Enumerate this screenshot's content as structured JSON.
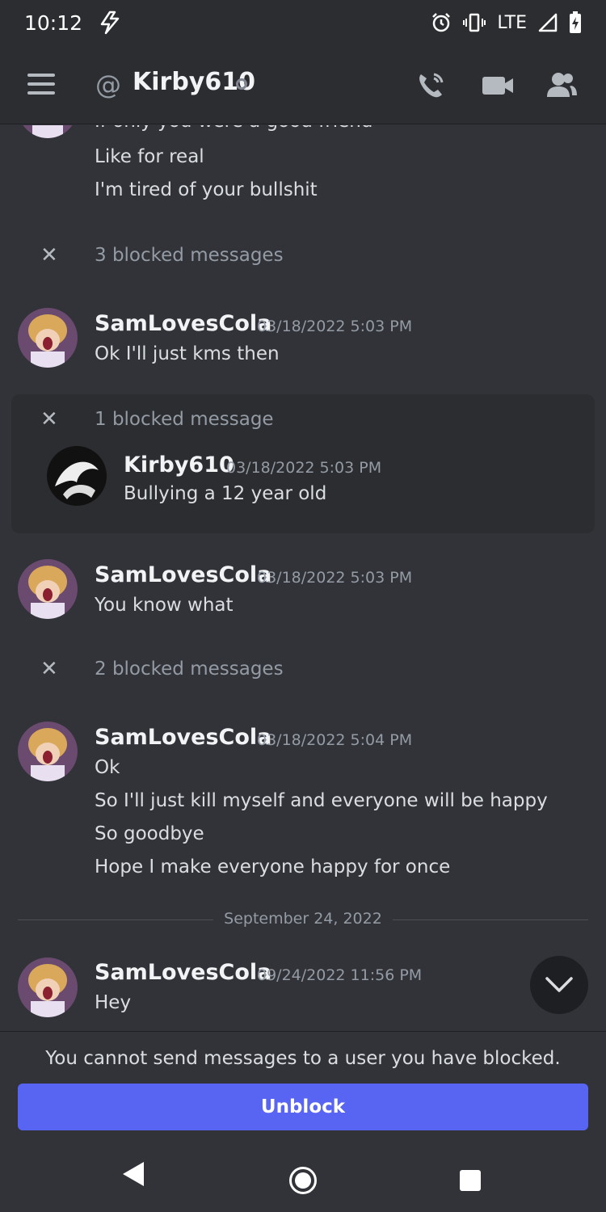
{
  "status_bar": {
    "time": "10:12",
    "network": "LTE"
  },
  "header": {
    "channel_name": "Kirby610"
  },
  "chat": {
    "top_lines": [
      "If only you were a good friend",
      "Like for real",
      "I'm tired of your bullshit"
    ],
    "blocked_1": "3 blocked messages",
    "msg1": {
      "author": "SamLovesCola",
      "timestamp": "03/18/2022 5:03 PM",
      "lines": [
        "Ok I'll just kms then"
      ]
    },
    "blocked_2": "1 blocked message",
    "blocked_msg": {
      "author": "Kirby610",
      "timestamp": "03/18/2022 5:03 PM",
      "lines": [
        "Bullying a 12 year old"
      ]
    },
    "msg2": {
      "author": "SamLovesCola",
      "timestamp": "03/18/2022 5:03 PM",
      "lines": [
        "You know what"
      ]
    },
    "blocked_3": "2 blocked messages",
    "msg3": {
      "author": "SamLovesCola",
      "timestamp": "03/18/2022 5:04 PM",
      "lines": [
        "Ok",
        "So I'll just kill myself and everyone will be happy",
        "So goodbye",
        "Hope I make everyone happy for once"
      ]
    },
    "date_divider": "September 24, 2022",
    "msg4": {
      "author": "SamLovesCola",
      "timestamp": "09/24/2022 11:56 PM",
      "lines": [
        "Hey"
      ]
    }
  },
  "footer": {
    "notice": "You cannot send messages to a user you have blocked.",
    "unblock_label": "Unblock"
  },
  "colors": {
    "accent": "#5865f2",
    "background": "#313338",
    "header": "#2b2d31"
  }
}
